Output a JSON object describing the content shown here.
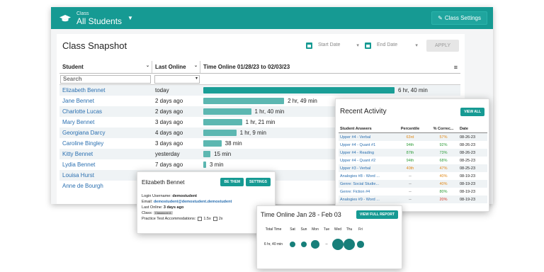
{
  "header": {
    "class_label": "Class",
    "class_name": "All Students",
    "settings_label": "Class Settings"
  },
  "snapshot": {
    "title": "Class Snapshot",
    "start_placeholder": "Start Date",
    "end_placeholder": "End Date",
    "apply_label": "APPLY",
    "columns": [
      "Student",
      "Last Online",
      "Time Online 01/28/23 to 02/03/23"
    ],
    "search_placeholder": "Search",
    "rows": [
      {
        "name": "Elizabeth Bennet",
        "last": "today",
        "time": "6 hr, 40 min",
        "minutes": 400
      },
      {
        "name": "Jane Bennet",
        "last": "2 days ago",
        "time": "2 hr, 49 min",
        "minutes": 169
      },
      {
        "name": "Charlotte Lucas",
        "last": "2 days ago",
        "time": "1 hr, 40 min",
        "minutes": 100
      },
      {
        "name": "Mary Bennet",
        "last": "3 days ago",
        "time": "1 hr, 21 min",
        "minutes": 81
      },
      {
        "name": "Georgiana Darcy",
        "last": "4 days ago",
        "time": "1 hr, 9 min",
        "minutes": 69
      },
      {
        "name": "Caroline Bingley",
        "last": "3 days ago",
        "time": "38 min",
        "minutes": 38
      },
      {
        "name": "Kitty Bennet",
        "last": "yesterday",
        "time": "15 min",
        "minutes": 15
      },
      {
        "name": "Lydia Bennet",
        "last": "7 days ago",
        "time": "3 min",
        "minutes": 3
      },
      {
        "name": "Louisa Hurst",
        "last": "",
        "time": "",
        "minutes": 0
      },
      {
        "name": "Anne de Bourgh",
        "last": "",
        "time": "",
        "minutes": 0
      }
    ]
  },
  "recent": {
    "title": "Recent Activity",
    "view_all": "VIEW ALL",
    "columns": [
      "Student Answers",
      "Percentile",
      "% Correc...",
      "Date"
    ],
    "rows": [
      {
        "answer": "Upper #4 - Verbal",
        "pct": "63rd",
        "correct": "57%",
        "date": "08-26-23",
        "color": "orange"
      },
      {
        "answer": "Upper #4 - Quant #1",
        "pct": "94th",
        "correct": "92%",
        "date": "08-26-23",
        "color": "green"
      },
      {
        "answer": "Upper #4 - Reading",
        "pct": "87th",
        "correct": "73%",
        "date": "08-26-23",
        "color": "green"
      },
      {
        "answer": "Upper #4 - Quant #2",
        "pct": "94th",
        "correct": "68%",
        "date": "08-25-23",
        "color": "green"
      },
      {
        "answer": "Upper #3 - Verbal",
        "pct": "40th",
        "correct": "47%",
        "date": "08-25-23",
        "color": "orange"
      },
      {
        "answer": "Analogies #8 - Word ...",
        "pct": "--",
        "correct": "40%",
        "date": "08-19-23",
        "color": "orange"
      },
      {
        "answer": "Genre: Social Studie...",
        "pct": "--",
        "correct": "40%",
        "date": "08-19-23",
        "color": "orange"
      },
      {
        "answer": "Genre: Fiction #4",
        "pct": "--",
        "correct": "80%",
        "date": "08-19-23",
        "color": "green"
      },
      {
        "answer": "Analogies #9 - Word ...",
        "pct": "--",
        "correct": "20%",
        "date": "08-19-23",
        "color": "red"
      }
    ]
  },
  "student_card": {
    "name": "Elizabeth Bennet",
    "be_them": "BE THEM",
    "settings": "SETTINGS",
    "username_label": "Login Username:",
    "username": "demostudent",
    "email_label": "Email:",
    "email": "demostudent@demostudent.demostudent",
    "last_online_label": "Last Online:",
    "last_online": "3 days ago",
    "class_label": "Class:",
    "class_value": "Classroom A",
    "accommodations_label": "Practice Test Accommodations:",
    "opt1": "1.5x",
    "opt2": "2x"
  },
  "time_online": {
    "title": "Time Online Jan 28 - Feb 03",
    "report_btn": "VIEW FULL REPORT",
    "total_label": "Total Time",
    "total_value": "6 hr, 40 min",
    "days": [
      "Sat",
      "Sun",
      "Mon",
      "Tue",
      "Wed",
      "Thu",
      "Fri"
    ],
    "day_levels": [
      0.35,
      0.35,
      0.6,
      0,
      1,
      1,
      0.4
    ],
    "tue_text": "--"
  }
}
